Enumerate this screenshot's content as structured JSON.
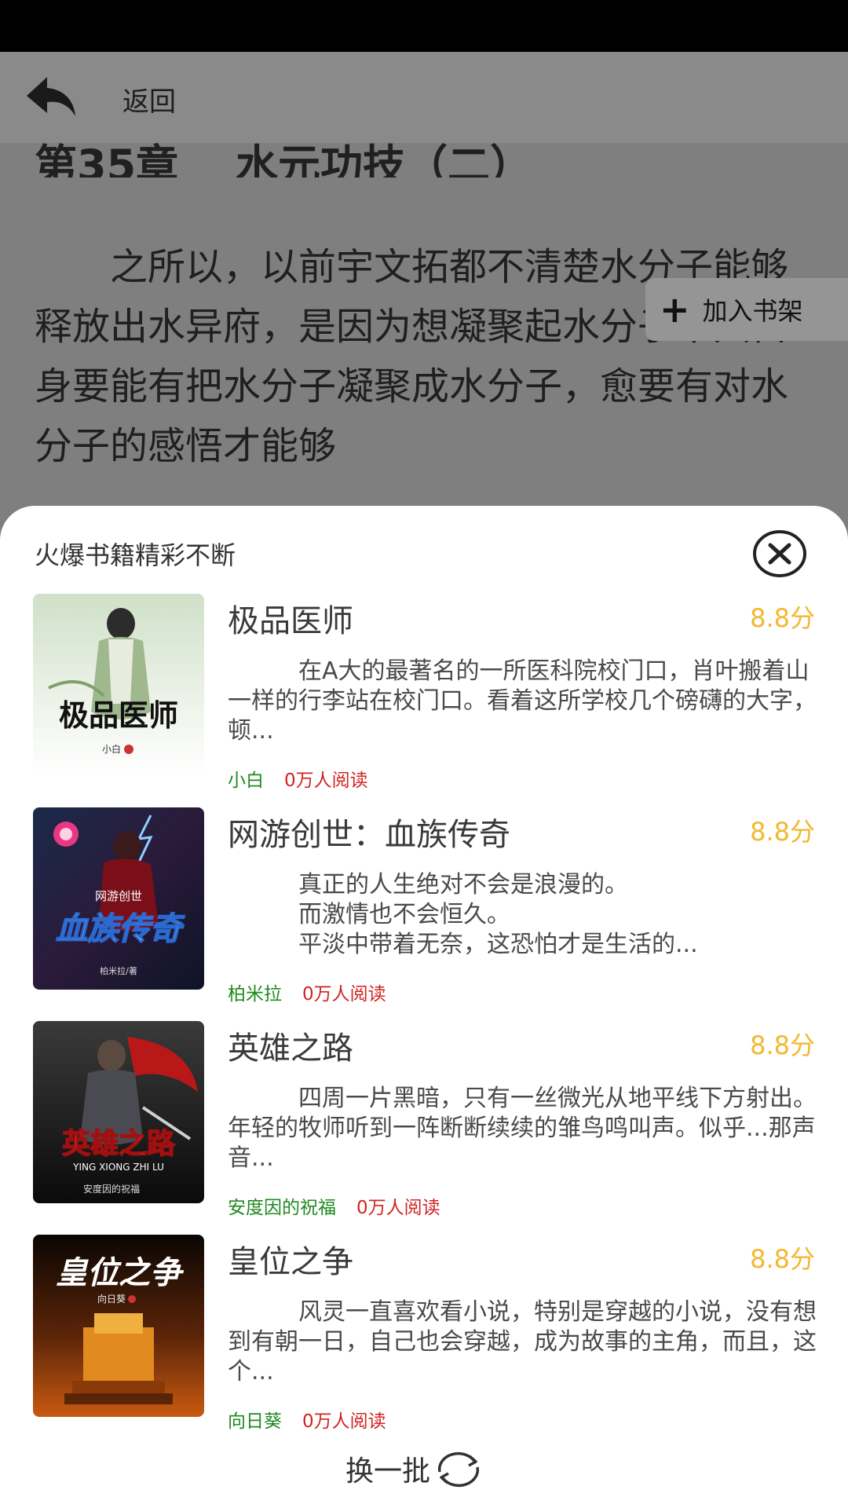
{
  "header": {
    "back_label": "返回"
  },
  "chapter": {
    "title": "第35章　 水元功技（二）",
    "paragraphs": [
      "　　之所以，以前宇文拓都不清楚水分子能够释放出水异府，是因为想凝聚起水分子不只自身要能有把水分子凝聚成水分子，愈要有对水分子的感悟才能够"
    ]
  },
  "bookshelf_button": {
    "label": "加入书架"
  },
  "sheet": {
    "title": "火爆书籍精彩不断",
    "books": [
      {
        "title": "极品医师",
        "score": "8.8分",
        "desc": "　　　在A大的最著名的一所医科院校门口，肖叶搬着山一样的行李站在校门口。看着这所学校几个磅礴的大字，顿...",
        "author": "小白",
        "reads": "0万人阅读",
        "cover_text": "极品医师",
        "cover_author": "小白"
      },
      {
        "title": "网游创世：血族传奇",
        "score": "8.8分",
        "desc_lines": [
          "　　　真正的人生绝对不会是浪漫的。",
          "　　　而激情也不会恒久。",
          "　　　平淡中带着无奈，这恐怕才是生活的..."
        ],
        "author": "柏米拉",
        "reads": "0万人阅读",
        "cover_text": "血族传奇",
        "cover_subtext": "网游创世",
        "cover_author": "柏米拉/著"
      },
      {
        "title": "英雄之路",
        "score": "8.8分",
        "desc": "　　　四周一片黑暗，只有一丝微光从地平线下方射出。年轻的牧师听到一阵断断续续的雏鸟鸣叫声。似乎...那声音...",
        "author": "安度因的祝福",
        "reads": "0万人阅读",
        "cover_text": "英雄之路",
        "cover_subtext": "YING XIONG ZHI LU",
        "cover_author": "安度因的祝福"
      },
      {
        "title": "皇位之争",
        "score": "8.8分",
        "desc": "　　　风灵一直喜欢看小说，特别是穿越的小说，没有想到有朝一日，自己也会穿越，成为故事的主角，而且，这个...",
        "author": "向日葵",
        "reads": "0万人阅读",
        "cover_text": "皇位之争",
        "cover_author": "向日葵"
      }
    ],
    "refresh_label": "换一批"
  }
}
